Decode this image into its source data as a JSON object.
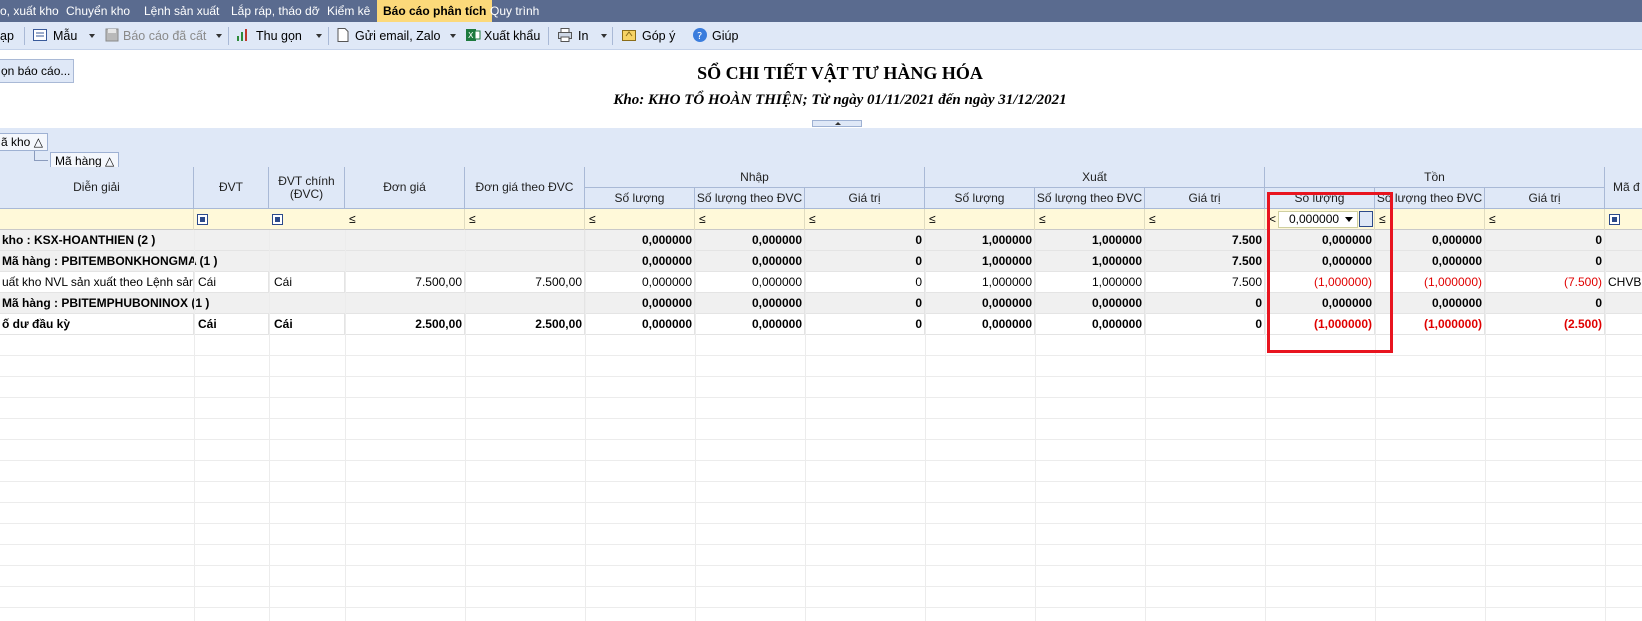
{
  "menu": [
    "o, xuất kho",
    "Chuyển kho",
    "Lệnh sản xuất",
    "Lắp ráp, tháo dỡ",
    "Kiểm kê",
    "Báo cáo phân tích",
    "Quy trình"
  ],
  "toolbar": {
    "items": [
      "ạp",
      "Mẫu",
      "Báo cáo đã cất",
      "Thu gọn",
      "Gửi email, Zalo",
      "Xuất khẩu",
      "In",
      "Góp ý",
      "Giúp"
    ]
  },
  "report": {
    "options_button": "ọn báo cáo...",
    "title": "SỔ CHI TIẾT VẬT TƯ HÀNG HÓA",
    "subtitle": "Kho: KHO TỔ HOÀN THIỆN; Từ ngày 01/11/2021 đến ngày 31/12/2021"
  },
  "grouping": {
    "chip1": "ã kho",
    "chip2": "Mã hàng"
  },
  "columns": {
    "dien_giai": "Diễn giải",
    "dvt": "ĐVT",
    "dvt_chinh": "ĐVT chính (ĐVC)",
    "don_gia": "Đơn giá",
    "don_gia_dvc": "Đơn giá theo ĐVC",
    "nhap": "Nhập",
    "xuat": "Xuất",
    "ton": "Tồn",
    "so_luong": "Số lượng",
    "so_luong_dvc": "Số lượng theo ĐVC",
    "gia_tri": "Giá trị",
    "ma": "Mã đ"
  },
  "filter": {
    "op_le": "≤",
    "op_lt": "<",
    "ton_value": "0,000000"
  },
  "rows": [
    [
      "kho : KSX-HOANTHIEN (2 )",
      "",
      "",
      "",
      "",
      "0,000000",
      "0,000000",
      "0",
      "1,000000",
      "1,000000",
      "7.500",
      "0,000000",
      "0,000000",
      "0",
      ""
    ],
    [
      "Mã hàng : PBITEMBONKHONGMA (1 )",
      "",
      "",
      "",
      "",
      "0,000000",
      "0,000000",
      "0",
      "1,000000",
      "1,000000",
      "7.500",
      "0,000000",
      "0,000000",
      "0",
      ""
    ],
    [
      "uất kho NVL sản xuất theo Lệnh sản x",
      "Cái",
      "Cái",
      "7.500,00",
      "7.500,00",
      "0,000000",
      "0,000000",
      "0",
      "1,000000",
      "1,000000",
      "7.500",
      "(1,000000)",
      "(1,000000)",
      "(7.500)",
      "CHVBB"
    ],
    [
      "Mã hàng : PBITEMPHUBONINOX (1 )",
      "",
      "",
      "",
      "",
      "0,000000",
      "0,000000",
      "0",
      "0,000000",
      "0,000000",
      "0",
      "0,000000",
      "0,000000",
      "0",
      ""
    ],
    [
      "ố dư đầu kỳ",
      "Cái",
      "Cái",
      "2.500,00",
      "2.500,00",
      "0,000000",
      "0,000000",
      "0",
      "0,000000",
      "0,000000",
      "0",
      "(1,000000)",
      "(1,000000)",
      "(2.500)",
      ""
    ]
  ]
}
